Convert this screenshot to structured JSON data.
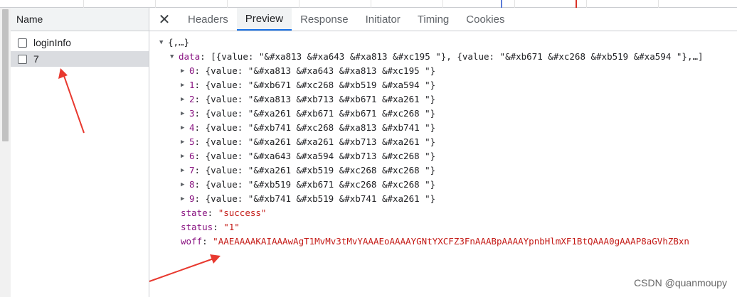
{
  "left_panel": {
    "header": "Name",
    "requests": [
      {
        "name": "loginInfo",
        "selected": false
      },
      {
        "name": "7",
        "selected": true
      }
    ]
  },
  "tabs": {
    "close_glyph": "✕",
    "items": [
      "Headers",
      "Preview",
      "Response",
      "Initiator",
      "Timing",
      "Cookies"
    ],
    "active": "Preview"
  },
  "preview": {
    "root": "{,…}",
    "data_key": "data",
    "data_summary": "[{value: \"&#xa813 &#xa643 &#xa813 &#xc195 \"}, {value: \"&#xb671 &#xc268 &#xb519 &#xa594 \"},…]",
    "items": [
      {
        "index": "0",
        "text": "{value: \"&#xa813 &#xa643 &#xa813 &#xc195 \"}"
      },
      {
        "index": "1",
        "text": "{value: \"&#xb671 &#xc268 &#xb519 &#xa594 \"}"
      },
      {
        "index": "2",
        "text": "{value: \"&#xa813 &#xb713 &#xb671 &#xa261 \"}"
      },
      {
        "index": "3",
        "text": "{value: \"&#xa261 &#xb671 &#xb671 &#xc268 \"}"
      },
      {
        "index": "4",
        "text": "{value: \"&#xb741 &#xc268 &#xa813 &#xb741 \"}"
      },
      {
        "index": "5",
        "text": "{value: \"&#xa261 &#xa261 &#xb713 &#xa261 \"}"
      },
      {
        "index": "6",
        "text": "{value: \"&#xa643 &#xa594 &#xb713 &#xc268 \"}"
      },
      {
        "index": "7",
        "text": "{value: \"&#xa261 &#xb519 &#xc268 &#xc268 \"}"
      },
      {
        "index": "8",
        "text": "{value: \"&#xb519 &#xb671 &#xc268 &#xc268 \"}"
      },
      {
        "index": "9",
        "text": "{value: \"&#xb741 &#xb519 &#xb741 &#xa261 \"}"
      }
    ],
    "state_key": "state",
    "state_value": "\"success\"",
    "status_key": "status",
    "status_value": "\"1\"",
    "woff_key": "woff",
    "woff_value": "\"AAEAAAAKAIAAAwAgT1MvMv3tMvYAAAEoAAAAYGNtYXCFZ3FnAAABpAAAAYpnbHlmXF1BtQAAA0gAAAP8aGVhZBxn"
  },
  "watermark": "CSDN @quanmoupy",
  "colors": {
    "key": "#881280",
    "string": "#c41a16",
    "arrow": "#e8392f",
    "active_tab": "#1a73e8"
  }
}
